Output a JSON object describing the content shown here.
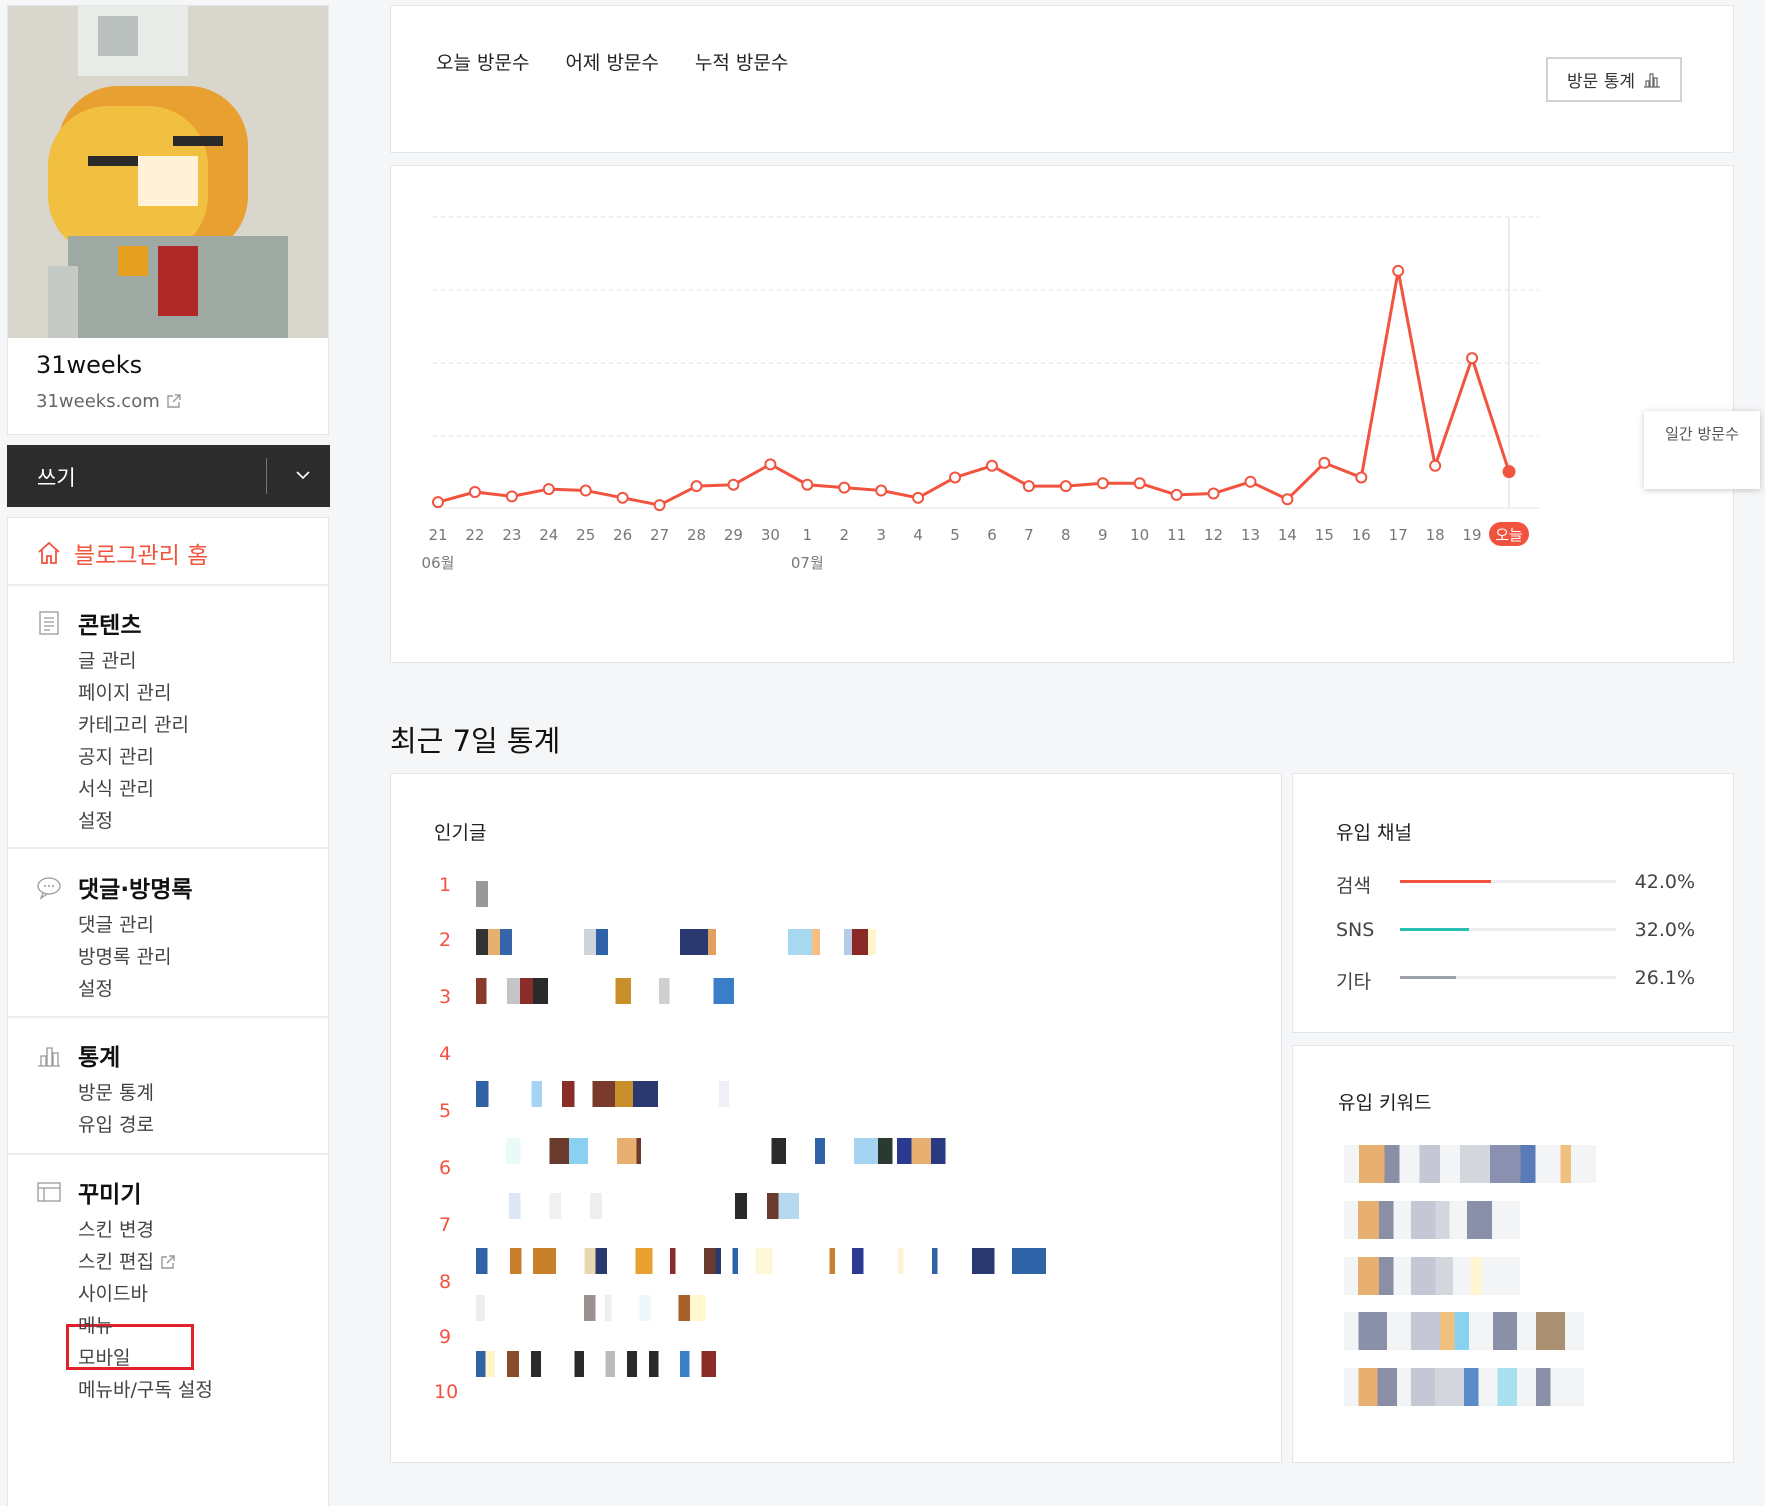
{
  "profile": {
    "name": "31weeks",
    "url": "31weeks.com"
  },
  "write": {
    "label": "쓰기"
  },
  "sidebar": {
    "home": "블로그관리 홈",
    "sections": [
      {
        "title": "콘텐츠",
        "items": [
          "글 관리",
          "페이지 관리",
          "카테고리 관리",
          "공지 관리",
          "서식 관리",
          "설정"
        ]
      },
      {
        "title": "댓글·방명록",
        "items": [
          "댓글 관리",
          "방명록 관리",
          "설정"
        ]
      },
      {
        "title": "통계",
        "items": [
          "방문 통계",
          "유입 경로"
        ]
      },
      {
        "title": "꾸미기",
        "items": [
          "스킨 변경",
          "스킨 편집",
          "사이드바",
          "메뉴",
          "모바일",
          "메뉴바/구독 설정"
        ]
      }
    ]
  },
  "stats_header": {
    "tabs": [
      "오늘 방문수",
      "어제 방문수",
      "누적 방문수"
    ],
    "visit_stats_button": "방문 통계"
  },
  "chart_data": {
    "type": "line",
    "x": [
      "21",
      "22",
      "23",
      "24",
      "25",
      "26",
      "27",
      "28",
      "29",
      "30",
      "1",
      "2",
      "3",
      "4",
      "5",
      "6",
      "7",
      "8",
      "9",
      "10",
      "11",
      "12",
      "13",
      "14",
      "15",
      "16",
      "17",
      "18",
      "19",
      "오늘"
    ],
    "month_labels": [
      "06월",
      "07월"
    ],
    "series": [
      {
        "values": [
          2,
          5.5,
          4,
          6.5,
          6,
          3.5,
          1,
          7.5,
          8,
          15,
          8,
          7,
          6,
          3.5,
          10.5,
          14.5,
          7.5,
          7.5,
          8.5,
          8.5,
          4.5,
          5,
          9,
          3,
          15.5,
          10.5,
          81.5,
          14.5,
          51.5,
          12.5
        ]
      }
    ],
    "grid": true,
    "color": "#f2533f",
    "highlight": "오늘",
    "tooltip": "일간 방문수"
  },
  "recent": {
    "title": "최근 7일 통계",
    "popular_title": "인기글",
    "ranks": [
      "1",
      "2",
      "3",
      "4",
      "5",
      "6",
      "7",
      "8",
      "9",
      "10"
    ],
    "channels_title": "유입 채널",
    "channels": [
      {
        "label": "검색",
        "value": 42.0,
        "pct": "42.0%",
        "color": "#f2533f"
      },
      {
        "label": "SNS",
        "value": 32.0,
        "pct": "32.0%",
        "color": "#27c0b0"
      },
      {
        "label": "기타",
        "value": 26.1,
        "pct": "26.1%",
        "color": "#9aa1ab"
      }
    ],
    "keywords_title": "유입 키워드"
  },
  "colors": {
    "accent": "#f2533f",
    "dark_bar": "#2c2c2c",
    "highlight_box": "#e0212b"
  }
}
